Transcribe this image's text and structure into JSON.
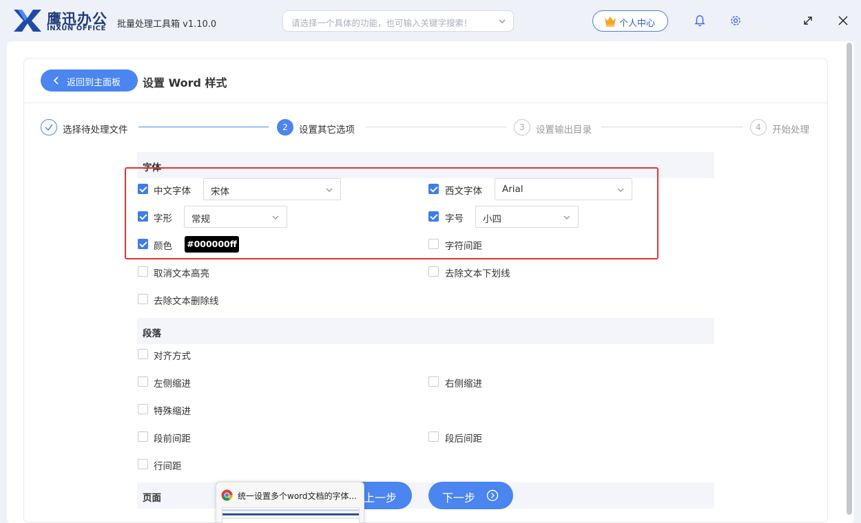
{
  "app": {
    "logo_cn": "鹰迅办公",
    "logo_en": "INXUN OFFICE",
    "title": "批量处理工具箱 v1.10.0",
    "search_placeholder": "请选择一个具体的功能，也可输入关键字搜索！",
    "user_center": "个人中心",
    "icons": [
      "bell-icon",
      "gear-icon",
      "expand-icon",
      "close-icon"
    ]
  },
  "header": {
    "back_label": "返回到主面板",
    "page_title": "设置 Word 样式"
  },
  "steps": [
    {
      "num": "✓",
      "label": "选择待处理文件",
      "state": "done"
    },
    {
      "num": "2",
      "label": "设置其它选项",
      "state": "active"
    },
    {
      "num": "3",
      "label": "设置输出目录",
      "state": "pending"
    },
    {
      "num": "4",
      "label": "开始处理",
      "state": "pending"
    }
  ],
  "font_section": {
    "title": "字体",
    "cn_font": {
      "label": "中文字体",
      "checked": true,
      "value": "宋体"
    },
    "west_font": {
      "label": "西文字体",
      "checked": true,
      "value": "Arial"
    },
    "style": {
      "label": "字形",
      "checked": true,
      "value": "常规"
    },
    "size": {
      "label": "字号",
      "checked": true,
      "value": "小四"
    },
    "color": {
      "label": "颜色",
      "checked": true,
      "value": "#000000ff"
    },
    "spacing": {
      "label": "字符间距",
      "checked": false
    },
    "remove_highlight": {
      "label": "取消文本高亮",
      "checked": false
    },
    "remove_underline": {
      "label": "去除文本下划线",
      "checked": false
    },
    "remove_strike": {
      "label": "去除文本删除线",
      "checked": false
    }
  },
  "para_section": {
    "title": "段落",
    "align": {
      "label": "对齐方式",
      "checked": false
    },
    "left_indent": {
      "label": "左侧缩进",
      "checked": false
    },
    "right_indent": {
      "label": "右侧缩进",
      "checked": false
    },
    "special_indent": {
      "label": "特殊缩进",
      "checked": false
    },
    "before_spacing": {
      "label": "段前间距",
      "checked": false
    },
    "after_spacing": {
      "label": "段后间距",
      "checked": false
    },
    "line_spacing": {
      "label": "行间距",
      "checked": false
    }
  },
  "page_section": {
    "title": "页面"
  },
  "footer": {
    "prev_label": "上一步",
    "next_label": "下一步"
  },
  "taskbar_preview": {
    "title": "统一设置多个word文档的字体..."
  },
  "colors": {
    "accent": "#4a85f0",
    "highlight": "#e8312f",
    "checkbox": "#3f7ce8"
  }
}
